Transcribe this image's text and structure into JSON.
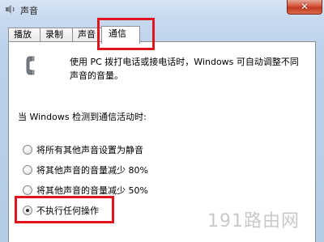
{
  "window": {
    "title": "声音",
    "close_label": "✕"
  },
  "tabs": [
    {
      "label": "播放",
      "active": false
    },
    {
      "label": "录制",
      "active": false
    },
    {
      "label": "声音",
      "active": false
    },
    {
      "label": "通信",
      "active": true
    }
  ],
  "communications": {
    "description": "使用 PC 拨打电话或接电话时，Windows 可自动调整不同声音的音量。",
    "description_line1": "使用 PC 拨打电话或接电话时，Windows 可自动调整不同",
    "description_line2": "声音的音量。",
    "when_label": "当 Windows 检测到通信活动时:",
    "options": [
      {
        "label": "将所有其他声音设置为静音",
        "checked": false
      },
      {
        "label": "将其他声音的音量减少 80%",
        "checked": false
      },
      {
        "label": "将其他声音的音量减少 50%",
        "checked": false
      },
      {
        "label": "不执行任何操作",
        "checked": true
      }
    ]
  },
  "watermark": "191路由网",
  "colors": {
    "highlight": "#e0141c",
    "title_bar": "#c7d9ef",
    "close_button": "#d7533c"
  },
  "icons": {
    "window": "speaker-icon",
    "communications": "phone-handset-icon"
  }
}
